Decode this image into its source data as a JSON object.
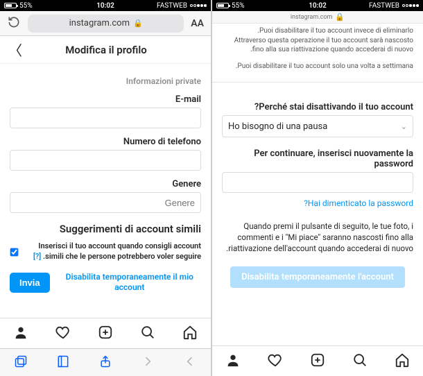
{
  "status": {
    "carrier": "FASTWEB",
    "time": "10:02",
    "battery_pct": "55%"
  },
  "left": {
    "url_host": "instagram.com",
    "intro_line1": "Puoi disabilitare il tuo account invece di eliminarlo.",
    "intro_line2": "Attraverso questa operazione il tuo account sarà nascosto fino alla sua riattivazione quando accederai di nuovo.",
    "intro_note": "Puoi disabilitare il tuo account solo una volta a settimana.",
    "q_label": "Perché stai disattivando il tuo account?",
    "reason_selected": "Ho bisogno di una pausa",
    "pw_label": "Per continuare, inserisci nuovamente la password",
    "forgot": "Hai dimenticato la password?",
    "explain": "Quando premi il pulsante di seguito, le tue foto, i commenti e i \"Mi piace\" saranno nascosti fino alla riattivazione dell'account quando accederai di nuovo.",
    "disable_btn": "Disabilita temporaneamente l'account"
  },
  "right": {
    "url_host": "instagram.com",
    "aa": "AA",
    "header_title": "Modifica il profilo",
    "priv_heading": "Informazioni private",
    "email_label": "E-mail",
    "phone_label": "Numero di telefono",
    "gender_label": "Genere",
    "gender_placeholder": "Genere",
    "suggest_heading": "Suggerimenti di account simili",
    "suggest_check": "Inserisci il tuo account quando consigli account simili che le persone potrebbero voler seguire.",
    "help_q": "[?]",
    "submit": "Invia",
    "disable_link": "Disabilita temporaneamente il mio account"
  }
}
